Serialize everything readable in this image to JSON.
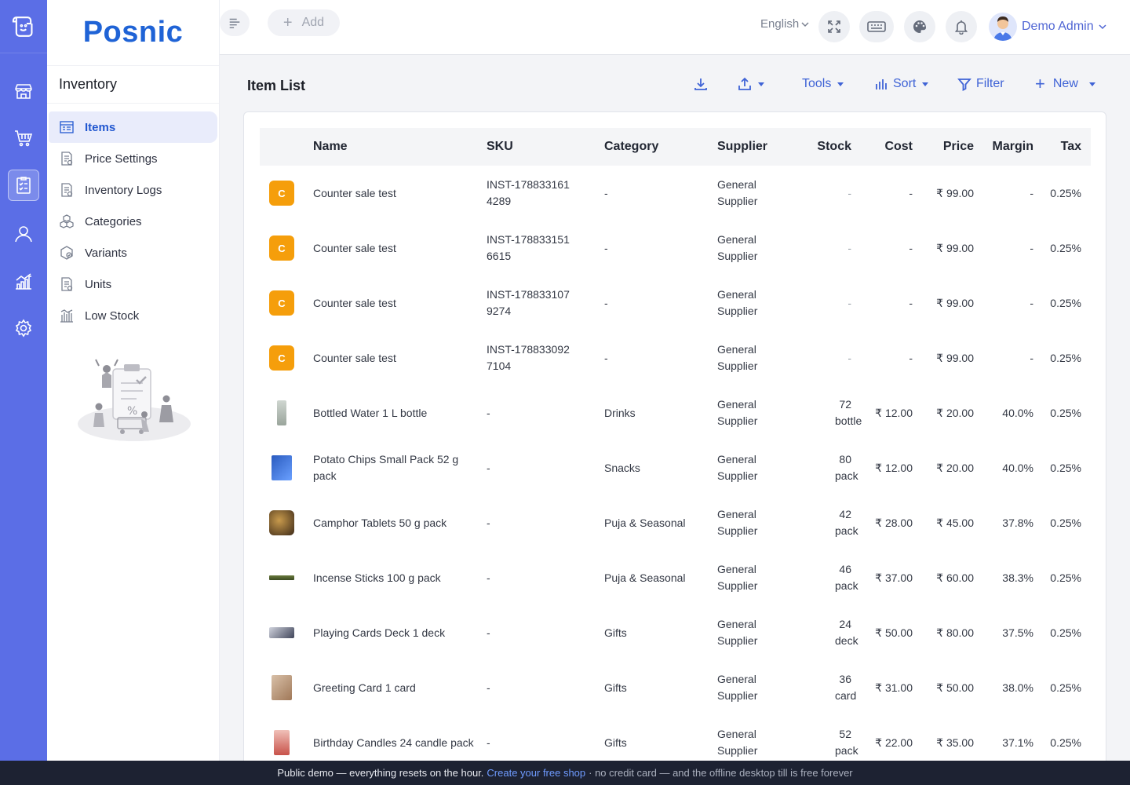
{
  "brand": "Posnic",
  "sidebar": {
    "title": "Inventory",
    "items": [
      {
        "label": "Items",
        "icon": "items-icon",
        "active": true
      },
      {
        "label": "Price Settings",
        "icon": "price-settings-icon"
      },
      {
        "label": "Inventory Logs",
        "icon": "inventory-logs-icon"
      },
      {
        "label": "Categories",
        "icon": "categories-icon"
      },
      {
        "label": "Variants",
        "icon": "variants-icon"
      },
      {
        "label": "Units",
        "icon": "units-icon"
      },
      {
        "label": "Low Stock",
        "icon": "low-stock-icon"
      }
    ]
  },
  "topbar": {
    "add_label": "Add",
    "language": "English",
    "user_name": "Demo Admin"
  },
  "main": {
    "title": "Item List",
    "toolbar": {
      "tools_label": "Tools",
      "sort_label": "Sort",
      "filter_label": "Filter",
      "new_label": "New"
    }
  },
  "table": {
    "columns": [
      "Name",
      "SKU",
      "Category",
      "Supplier",
      "Stock",
      "Cost",
      "Price",
      "Margin",
      "Tax"
    ],
    "rows": [
      {
        "thumb": "C",
        "name": "Counter sale test",
        "sku": "INST-1788331614289",
        "category": "-",
        "supplier": "General Supplier",
        "stock": "-",
        "cost": "-",
        "price": "₹ 99.00",
        "margin": "-",
        "tax": "0.25%"
      },
      {
        "thumb": "C",
        "name": "Counter sale test",
        "sku": "INST-1788331516615",
        "category": "-",
        "supplier": "General Supplier",
        "stock": "-",
        "cost": "-",
        "price": "₹ 99.00",
        "margin": "-",
        "tax": "0.25%"
      },
      {
        "thumb": "C",
        "name": "Counter sale test",
        "sku": "INST-1788331079274",
        "category": "-",
        "supplier": "General Supplier",
        "stock": "-",
        "cost": "-",
        "price": "₹ 99.00",
        "margin": "-",
        "tax": "0.25%"
      },
      {
        "thumb": "C",
        "name": "Counter sale test",
        "sku": "INST-1788330927104",
        "category": "-",
        "supplier": "General Supplier",
        "stock": "-",
        "cost": "-",
        "price": "₹ 99.00",
        "margin": "-",
        "tax": "0.25%"
      },
      {
        "thumb": "img",
        "name": "Bottled Water 1 L bottle",
        "sku": "-",
        "category": "Drinks",
        "supplier": "General Supplier",
        "stock": "72 bottle",
        "cost": "₹ 12.00",
        "price": "₹ 20.00",
        "margin": "40.0%",
        "tax": "0.25%"
      },
      {
        "thumb": "img",
        "name": "Potato Chips Small Pack 52 g pack",
        "sku": "-",
        "category": "Snacks",
        "supplier": "General Supplier",
        "stock": "80 pack",
        "cost": "₹ 12.00",
        "price": "₹ 20.00",
        "margin": "40.0%",
        "tax": "0.25%"
      },
      {
        "thumb": "img",
        "name": "Camphor Tablets 50 g pack",
        "sku": "-",
        "category": "Puja & Seasonal",
        "supplier": "General Supplier",
        "stock": "42 pack",
        "cost": "₹ 28.00",
        "price": "₹ 45.00",
        "margin": "37.8%",
        "tax": "0.25%"
      },
      {
        "thumb": "img",
        "name": "Incense Sticks 100 g pack",
        "sku": "-",
        "category": "Puja & Seasonal",
        "supplier": "General Supplier",
        "stock": "46 pack",
        "cost": "₹ 37.00",
        "price": "₹ 60.00",
        "margin": "38.3%",
        "tax": "0.25%"
      },
      {
        "thumb": "img",
        "name": "Playing Cards Deck 1 deck",
        "sku": "-",
        "category": "Gifts",
        "supplier": "General Supplier",
        "stock": "24 deck",
        "cost": "₹ 50.00",
        "price": "₹ 80.00",
        "margin": "37.5%",
        "tax": "0.25%"
      },
      {
        "thumb": "img",
        "name": "Greeting Card 1 card",
        "sku": "-",
        "category": "Gifts",
        "supplier": "General Supplier",
        "stock": "36 card",
        "cost": "₹ 31.00",
        "price": "₹ 50.00",
        "margin": "38.0%",
        "tax": "0.25%"
      },
      {
        "thumb": "img",
        "name": "Birthday Candles 24 candle pack",
        "sku": "-",
        "category": "Gifts",
        "supplier": "General Supplier",
        "stock": "52 pack",
        "cost": "₹ 22.00",
        "price": "₹ 35.00",
        "margin": "37.1%",
        "tax": "0.25%"
      }
    ]
  },
  "banner": {
    "lead": "Public demo — everything resets on the hour.",
    "link": "Create your free shop",
    "tail": "· no credit card — and the offline desktop till is free forever"
  },
  "colors": {
    "rail": "#5b6ee6",
    "accent": "#3f63d6",
    "letter_thumb": "#f59e0b",
    "banner_bg": "#1d2232"
  }
}
